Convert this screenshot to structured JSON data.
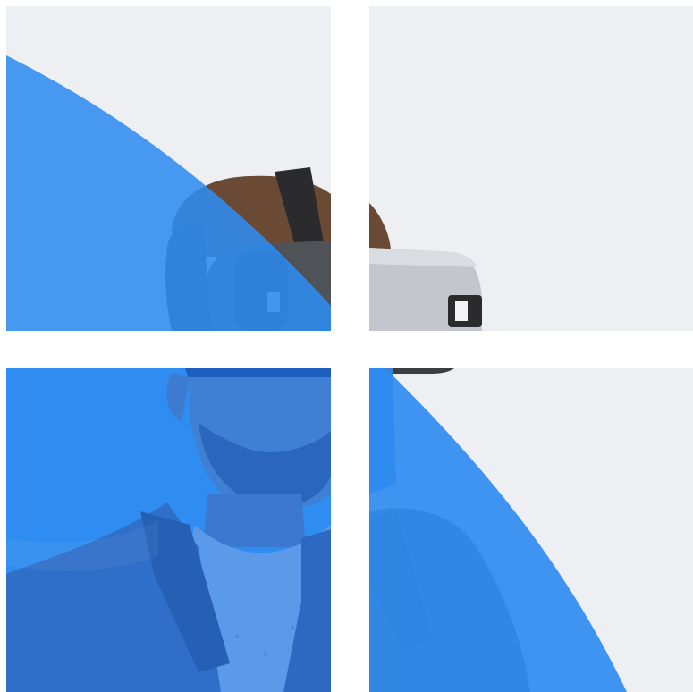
{
  "image": {
    "subject": "person-wearing-vr-headset",
    "tiles": [
      "top-left",
      "top-right",
      "bottom-left",
      "bottom-right"
    ]
  },
  "colors": {
    "accent": "#2f8cf0",
    "accent_light": "#3a97f2",
    "background": "#eeeff2",
    "gutter": "#ffffff",
    "headset": "#b9bcc2",
    "headset_strap": "#2b2b2e",
    "hair": "#6b4a35",
    "skin_tint": "#4a86d6",
    "jacket_tint": "#2f6fc9",
    "shirt_tint": "#5a9ae8"
  }
}
